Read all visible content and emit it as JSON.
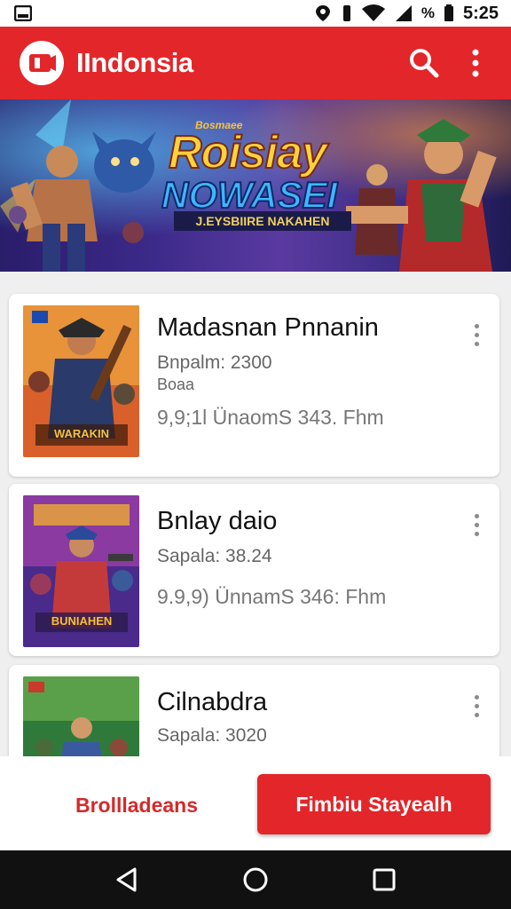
{
  "status_bar": {
    "percent_text": "%",
    "time": "5:25"
  },
  "app_bar": {
    "title": "IIndonsia",
    "icons": [
      "app-logo-icon",
      "search-icon",
      "more-vert-icon"
    ]
  },
  "banner": {
    "small_tag": "Bosmaee",
    "title_line1": "Roisiay",
    "title_line2": "NOWASEI",
    "subtitle": "J.EYSBIIRE NAKAHEN"
  },
  "games": [
    {
      "title": "Madasnan Pnnanin",
      "line1": "Bnpalm: 2300",
      "line2": "Boaa",
      "meta": "9,9;1l  ÜnaomS 343. Fhm",
      "thumb_caption": "WARAKIN"
    },
    {
      "title": "Bnlay daio",
      "line1": "Sapala: 38.24",
      "line2": "",
      "meta": "9.9,9)  ÜnnamS 346: Fhm",
      "thumb_caption": "BUNIAHEN"
    },
    {
      "title": "Cilnabdra",
      "line1": "Sapala: 3020",
      "line2": "",
      "meta": "",
      "thumb_caption": ""
    }
  ],
  "actions": {
    "secondary_label": "Brollladeans",
    "primary_label": "Fimbiu Stayealh"
  },
  "colors": {
    "brand_red": "#e2262a",
    "nav_bar": "#111111",
    "card_bg": "#ffffff"
  }
}
